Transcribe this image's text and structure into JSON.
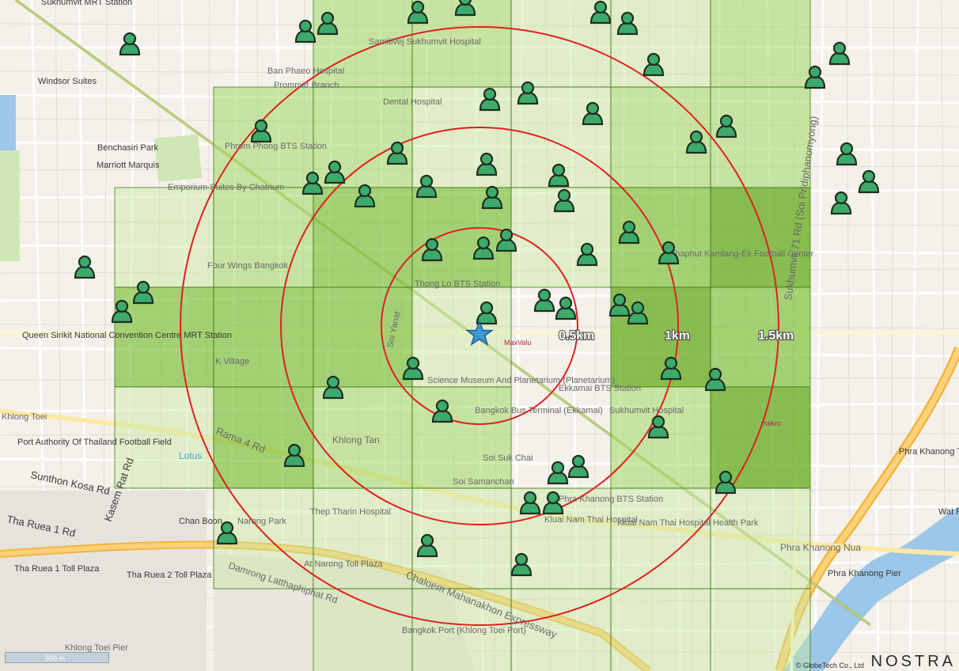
{
  "colors": {
    "grid_light": "#e8f5d8",
    "grid_mid": "#bfe28f",
    "grid_dark": "#8fc84a",
    "grid_darker": "#6fae2c",
    "ring": "#e02020",
    "person": "#3daa6a",
    "star": "#3b9ad6"
  },
  "map": {
    "place_labels": [
      "Sukhumvit MRT Station",
      "Windsor Suites",
      "Benchasiri Park",
      "Marriott Marquis",
      "Emporium Suites By Chatrium",
      "Ban Phaeo Hospital",
      "Prommitr Branch",
      "Samitivej Sukhumvit Hospital",
      "Dental Hospital",
      "Phrom Phong BTS Station",
      "Four Wings Bangkok",
      "Queen Sirikit National Convention Centre MRT Station",
      "K Village",
      "Khlong Toei",
      "Port Authority Of Thailand Football Field",
      "Sunthon Kosa Rd",
      "Kasem Rat Rd",
      "Tha Ruea 1 Rd",
      "Tha Ruea 1 Toll Plaza",
      "Tha Ruea 2 Toll Plaza",
      "Chan Boon",
      "Damrong Latthaphiphat Rd",
      "Rama 4 Rd",
      "Khlong Tan",
      "Lotus",
      "Thong Lo BTS Station",
      "Soi Yanat",
      "Science Museum And Planetarium (Planetarium)",
      "Bangkok Bus Terminal (Ekkamai)",
      "Ekkamai BTS Station",
      "Sukhumvit Hospital",
      "Soi Suk Chai",
      "Soi Samanchan",
      "Thep Tharin Hospital",
      "Phra Khanong BTS Station",
      "Kluai Nam Thai Hospital",
      "Kluai Nam Thai Hospital Health Park",
      "Narong Park",
      "At Narong Toll Plaza",
      "Chaloem Mahanakhon Expressway",
      "Bangkok Port (Khlong Toei Port)",
      "Sukhumvit 71 Rd (Soi Pridiphanomyong)",
      "Phaphut Kamlang-Ek Football Center",
      "Phra Khanong Toll Plaza",
      "Phra Khanong Nua",
      "Phra Khanong Pier",
      "Wat Pier",
      "Khlong Toei Pier",
      "MaxValu",
      "makro"
    ],
    "ring_labels": [
      "0.5km",
      "1km",
      "1.5km"
    ],
    "scale_label": "500 m",
    "copyright": "© GlobeTech Co., Ltd",
    "brand": "NOSTRA"
  }
}
